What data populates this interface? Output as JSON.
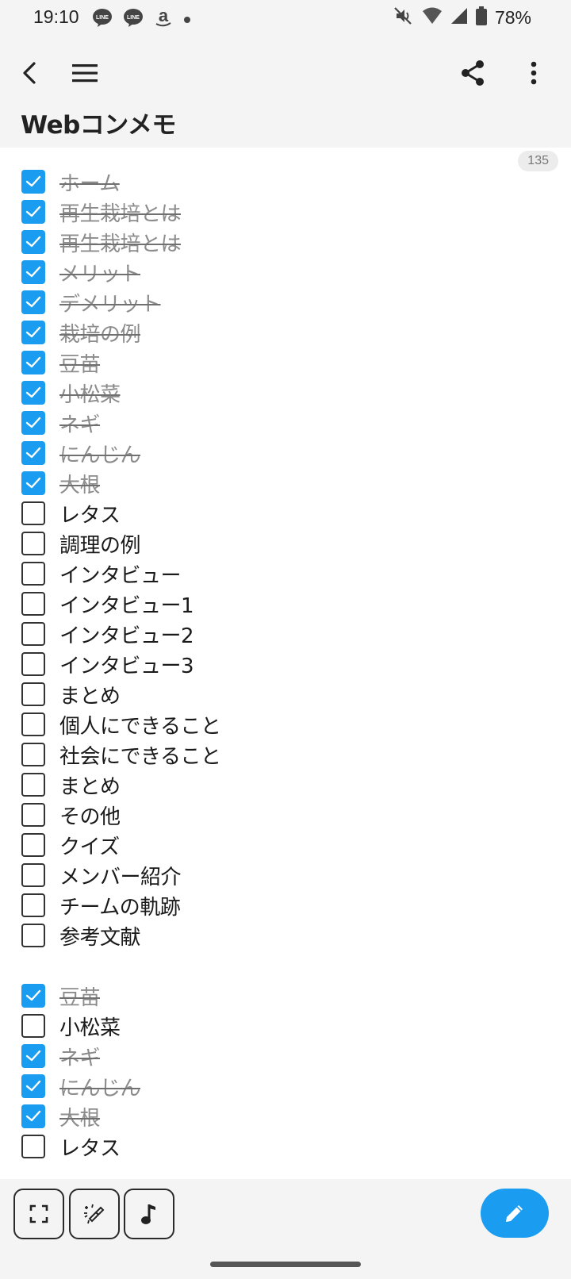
{
  "status_bar": {
    "time": "19:10",
    "battery": "78%",
    "icons": [
      "line-icon",
      "line-icon",
      "amazon-icon",
      "dot-icon",
      "mute-icon",
      "wifi-icon",
      "signal-icon",
      "battery-icon"
    ]
  },
  "toolbar": {
    "back_icon": "back-arrow-icon",
    "menu_icon": "hamburger-icon",
    "share_icon": "share-icon",
    "more_icon": "more-vert-icon"
  },
  "note": {
    "title": "Webコンメモ",
    "char_count": "135"
  },
  "checklist": [
    {
      "label": "ホーム",
      "checked": true
    },
    {
      "label": "再生栽培とは",
      "checked": true
    },
    {
      "label": "再生栽培とは",
      "checked": true
    },
    {
      "label": "メリット",
      "checked": true
    },
    {
      "label": "デメリット",
      "checked": true
    },
    {
      "label": "栽培の例",
      "checked": true
    },
    {
      "label": "豆苗",
      "checked": true
    },
    {
      "label": "小松菜",
      "checked": true
    },
    {
      "label": "ネギ",
      "checked": true
    },
    {
      "label": "にんじん",
      "checked": true
    },
    {
      "label": "大根",
      "checked": true
    },
    {
      "label": "レタス",
      "checked": false
    },
    {
      "label": "調理の例",
      "checked": false
    },
    {
      "label": "インタビュー",
      "checked": false
    },
    {
      "label": "インタビュー1",
      "checked": false
    },
    {
      "label": "インタビュー2",
      "checked": false
    },
    {
      "label": "インタビュー3",
      "checked": false
    },
    {
      "label": "まとめ",
      "checked": false
    },
    {
      "label": "個人にできること",
      "checked": false
    },
    {
      "label": "社会にできること",
      "checked": false
    },
    {
      "label": "まとめ",
      "checked": false
    },
    {
      "label": "その他",
      "checked": false
    },
    {
      "label": "クイズ",
      "checked": false
    },
    {
      "label": "メンバー紹介",
      "checked": false
    },
    {
      "label": "チームの軌跡",
      "checked": false
    },
    {
      "label": "参考文献",
      "checked": false
    },
    {
      "spacer": true
    },
    {
      "label": "豆苗",
      "checked": true
    },
    {
      "label": "小松菜",
      "checked": false
    },
    {
      "label": "ネギ",
      "checked": true
    },
    {
      "label": "にんじん",
      "checked": true
    },
    {
      "label": "大根",
      "checked": true
    },
    {
      "label": "レタス",
      "checked": false
    }
  ],
  "bottom_bar": {
    "buttons": [
      "fullscreen-icon",
      "magic-wand-icon",
      "music-note-icon"
    ],
    "fab_icon": "pencil-icon"
  },
  "colors": {
    "accent": "#1a9df0",
    "background": "#f4f4f4",
    "note_background": "#ffffff",
    "done_text": "#8c8c8c"
  }
}
